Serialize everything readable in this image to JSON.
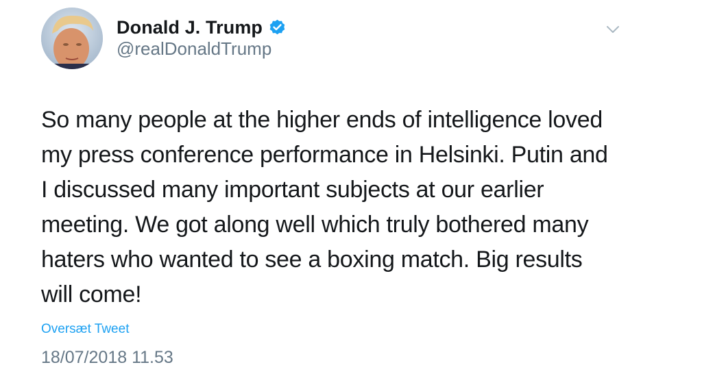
{
  "author": {
    "display_name": "Donald J. Trump",
    "handle": "@realDonaldTrump",
    "verified": true
  },
  "tweet": {
    "text": "So many people at the higher ends of intelligence loved\nmy press conference performance in Helsinki. Putin and\nI discussed many important subjects at our earlier\nmeeting. We got along well which truly bothered many\nhaters who wanted to see a boxing match. Big results\nwill come!",
    "translate_label": "Oversæt Tweet",
    "timestamp": "18/07/2018 11.53"
  },
  "icons": {
    "verified": "verified-badge-icon",
    "more": "chevron-down-icon"
  },
  "colors": {
    "link_blue": "#1da1f2",
    "muted_gray": "#657786",
    "text": "#14171a"
  }
}
